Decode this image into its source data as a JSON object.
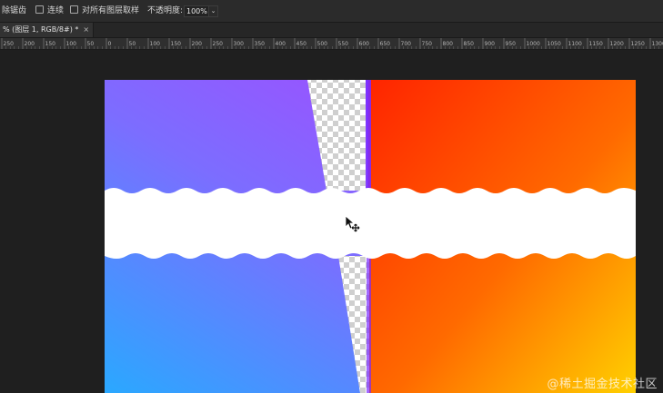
{
  "options_bar": {
    "item1_label": "除锯齿",
    "item2_label": "连续",
    "item3_label": "对所有图层取样",
    "opacity_label": "不透明度:",
    "opacity_value": "100%",
    "dropdown_glyph": "⌄"
  },
  "tab": {
    "title": "% (图层 1, RGB/8#) *",
    "close_glyph": "×"
  },
  "ruler": {
    "labels": [
      "250",
      "200",
      "150",
      "100",
      "50",
      "0",
      "50",
      "100",
      "150",
      "200",
      "250",
      "300",
      "350",
      "400",
      "450",
      "500",
      "550",
      "600",
      "650",
      "700",
      "750",
      "800",
      "850",
      "900",
      "950",
      "1000",
      "1050",
      "1100",
      "1150",
      "1200",
      "1250",
      "1300"
    ]
  },
  "watermark": "@稀土掘金技术社区",
  "colors": {
    "panel": "#2b2b2b",
    "workspace": "#1f1f1f",
    "purple": "#9b4dff",
    "blue": "#3ea8ff",
    "red": "#ff2a00",
    "yellow": "#ffd400"
  },
  "icons": {
    "cursor": "move-cursor-icon"
  }
}
